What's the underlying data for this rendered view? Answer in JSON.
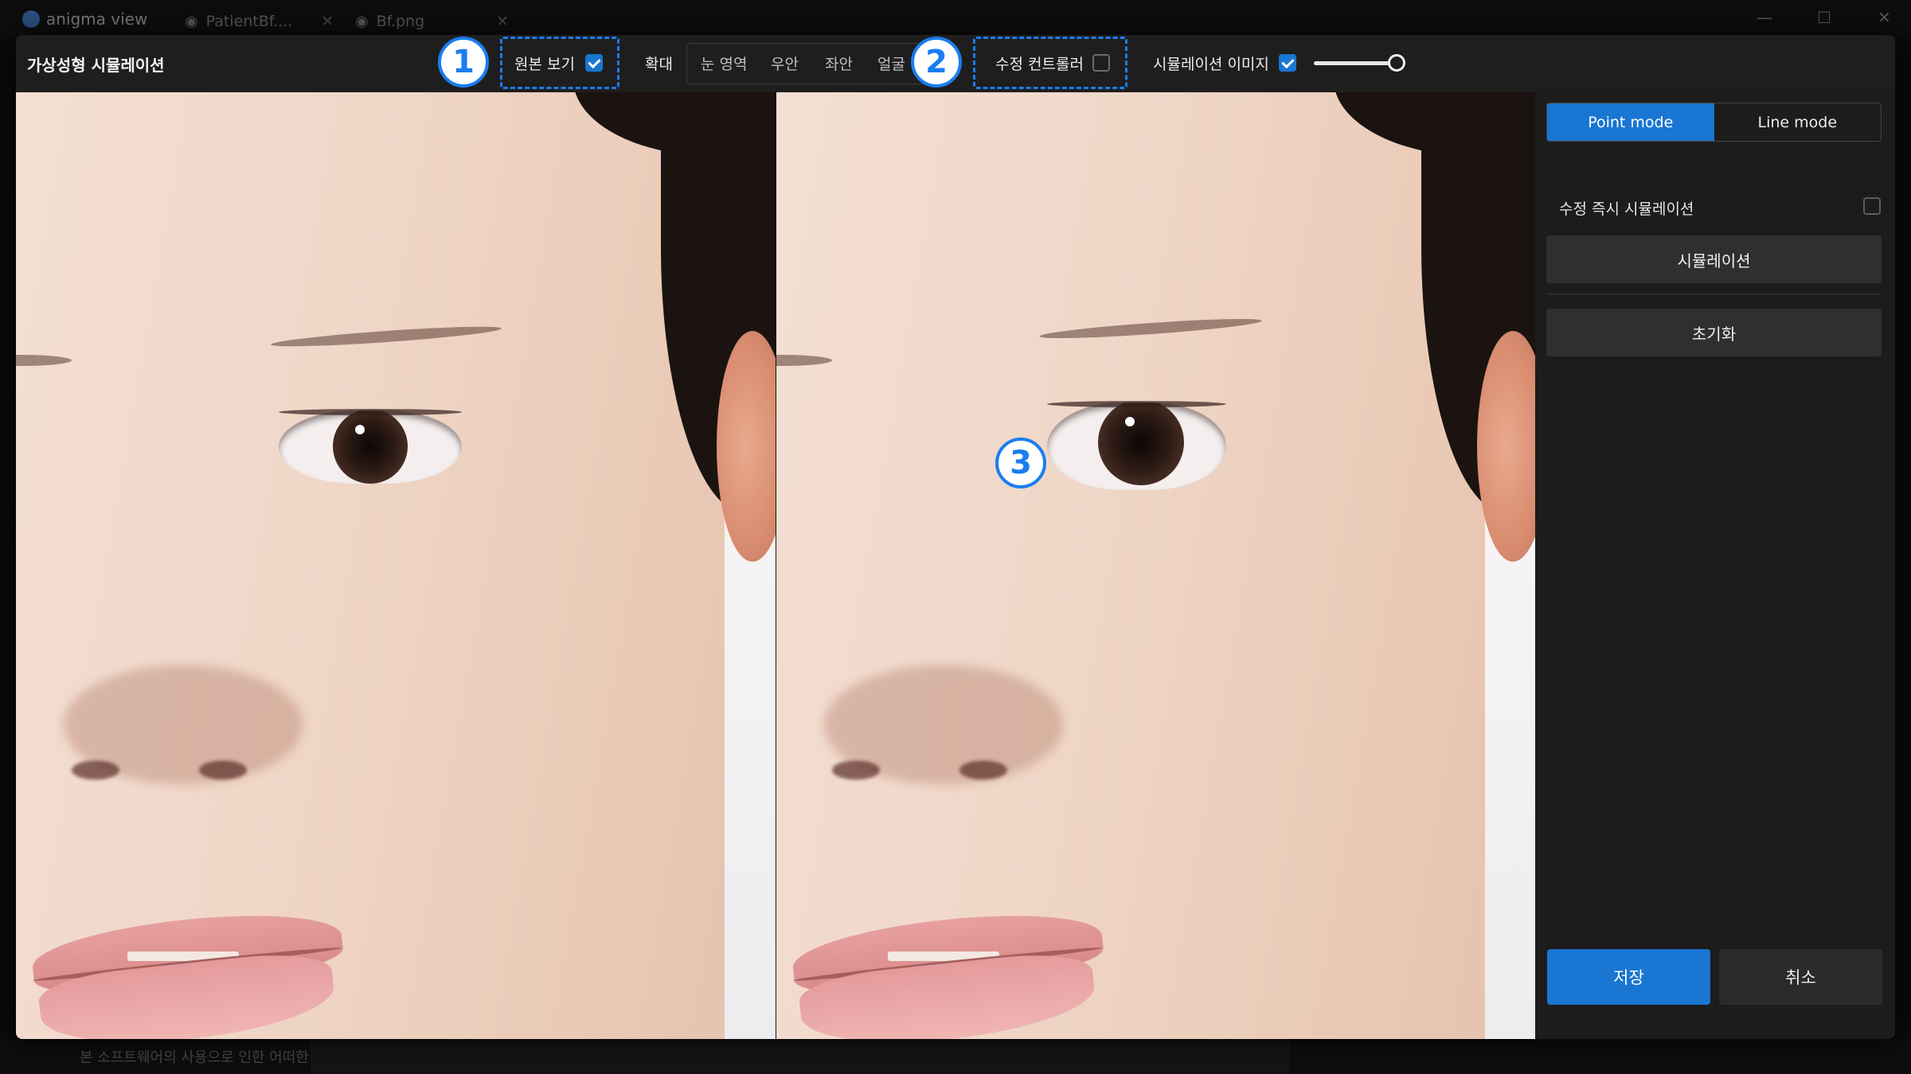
{
  "background_app": {
    "app_name": "anigma view",
    "tabs": [
      {
        "label": "PatientBf...."
      },
      {
        "label": "Bf.png"
      }
    ],
    "footer_text": "본 소프트웨어의 사용으로 인한 어떠한"
  },
  "dialog": {
    "title": "가상성형 시뮬레이션",
    "toolbar": {
      "show_original": {
        "label": "원본 보기",
        "checked": true
      },
      "zoom_label": "확대",
      "zoom_options": [
        "눈 영역",
        "우안",
        "좌안",
        "얼굴 전"
      ],
      "edit_controller": {
        "label": "수정 컨트롤러",
        "checked": false
      },
      "sim_image": {
        "label": "시뮬레이션 이미지",
        "checked": true
      },
      "opacity_slider": 1.0
    },
    "callouts": [
      "1",
      "2",
      "3"
    ],
    "side_panel": {
      "modes": [
        "Point mode",
        "Line mode"
      ],
      "active_mode": "Point mode",
      "instant_sim": {
        "label": "수정 즉시 시뮬레이션",
        "checked": false
      },
      "simulate_button": "시뮬레이션",
      "reset_button": "초기화",
      "save_button": "저장",
      "cancel_button": "취소"
    }
  },
  "colors": {
    "accent": "#1976d2",
    "callout": "#1a7df0",
    "panel_bg": "#1e1e1e"
  }
}
